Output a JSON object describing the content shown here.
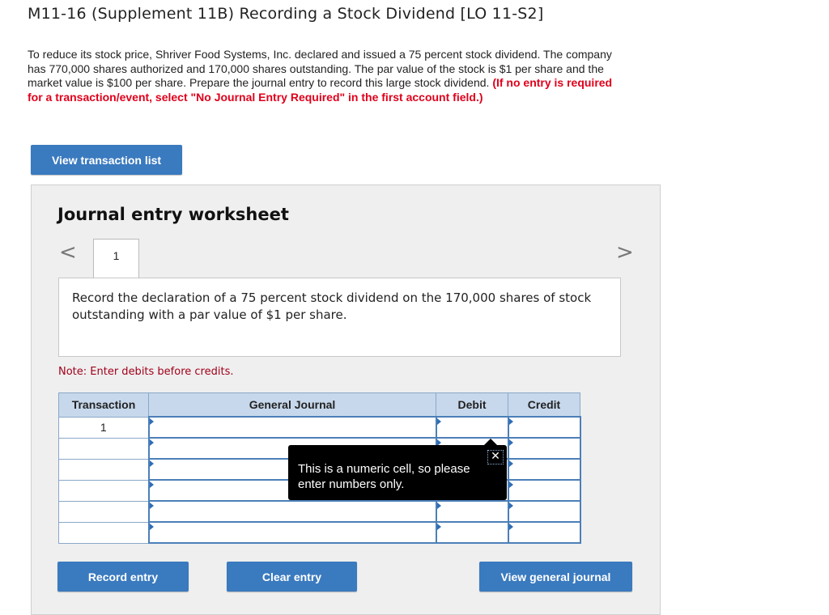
{
  "header": {
    "title": "M11-16 (Supplement 11B) Recording a Stock Dividend [LO 11-S2]"
  },
  "prompt": {
    "body": "To reduce its stock price, Shriver Food Systems, Inc. declared and issued a 75 percent stock dividend. The company has 770,000 shares authorized and 170,000 shares outstanding. The par value of the stock is $1 per share and the market value is $100 per share. Prepare the journal entry to record this large stock dividend.",
    "instruction": "(If no entry is required for a transaction/event, select \"No Journal Entry Required\" in the first account field.)"
  },
  "buttons": {
    "view_transactions": "View transaction list",
    "record_entry": "Record entry",
    "clear_entry": "Clear entry",
    "view_general_journal": "View general journal"
  },
  "worksheet": {
    "title": "Journal entry worksheet",
    "prev_arrow": "<",
    "next_arrow": ">",
    "tab_label": "1",
    "description": "Record the declaration of a 75 percent stock dividend on the 170,000 shares of stock outstanding with a par value of $1 per share.",
    "note": "Note: Enter debits before credits."
  },
  "table": {
    "headers": [
      "Transaction",
      "General Journal",
      "Debit",
      "Credit"
    ],
    "rows": [
      {
        "transaction": "1",
        "account": "",
        "debit": "",
        "credit": ""
      },
      {
        "transaction": "",
        "account": "",
        "debit": "",
        "credit": ""
      },
      {
        "transaction": "",
        "account": "",
        "debit": "",
        "credit": ""
      },
      {
        "transaction": "",
        "account": "",
        "debit": "",
        "credit": ""
      },
      {
        "transaction": "",
        "account": "",
        "debit": "",
        "credit": ""
      },
      {
        "transaction": "",
        "account": "",
        "debit": "",
        "credit": ""
      }
    ]
  },
  "tooltip": {
    "text": "This is a numeric cell, so please enter numbers only.",
    "close_glyph": "✕"
  },
  "colors": {
    "button_blue": "#3a7abf",
    "header_blue": "#c7d8ec",
    "alert_red": "#e0001b",
    "note_red": "#a1001a"
  }
}
